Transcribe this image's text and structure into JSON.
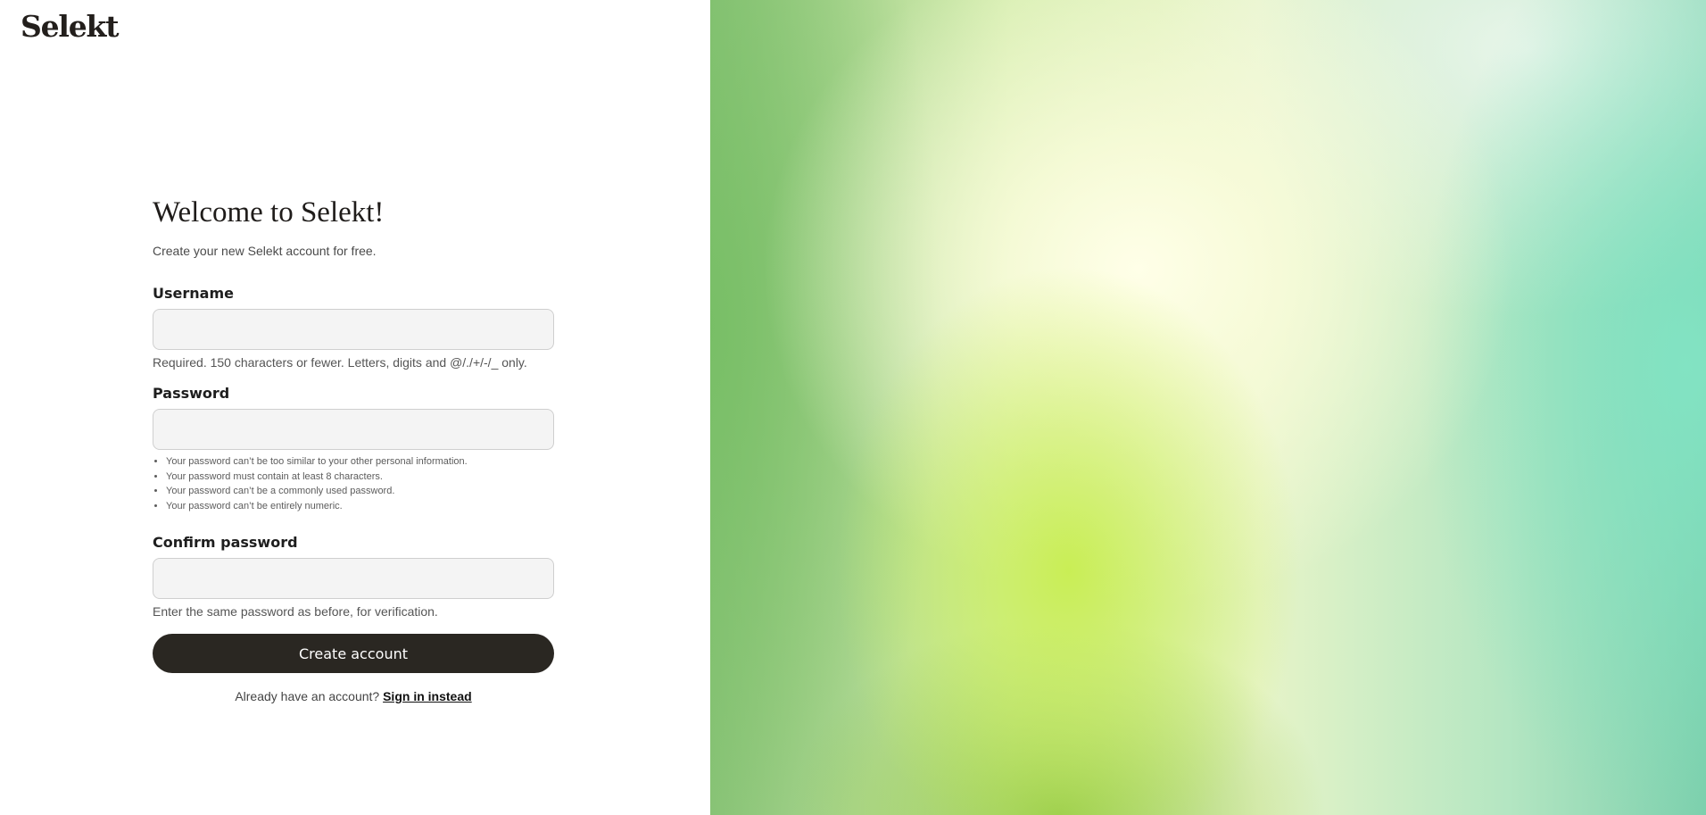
{
  "brand": {
    "logo_text": "Selekt"
  },
  "form": {
    "title": "Welcome to Selekt!",
    "subtitle": "Create your new Selekt account for free.",
    "username": {
      "label": "Username",
      "value": "",
      "help": "Required. 150 characters or fewer. Letters, digits and @/./+/-/_ only."
    },
    "password": {
      "label": "Password",
      "value": "",
      "rules": [
        "Your password can’t be too similar to your other personal information.",
        "Your password must contain at least 8 characters.",
        "Your password can’t be a commonly used password.",
        "Your password can’t be entirely numeric."
      ]
    },
    "confirm_password": {
      "label": "Confirm password",
      "value": "",
      "help": "Enter the same password as before, for verification."
    },
    "submit_label": "Create account",
    "signin_prompt": "Already have an account?",
    "signin_link": "Sign in instead"
  },
  "colors": {
    "primary_button": "#2a2722",
    "input_background": "#f4f4f4",
    "text_dark": "#1f1c1a"
  }
}
